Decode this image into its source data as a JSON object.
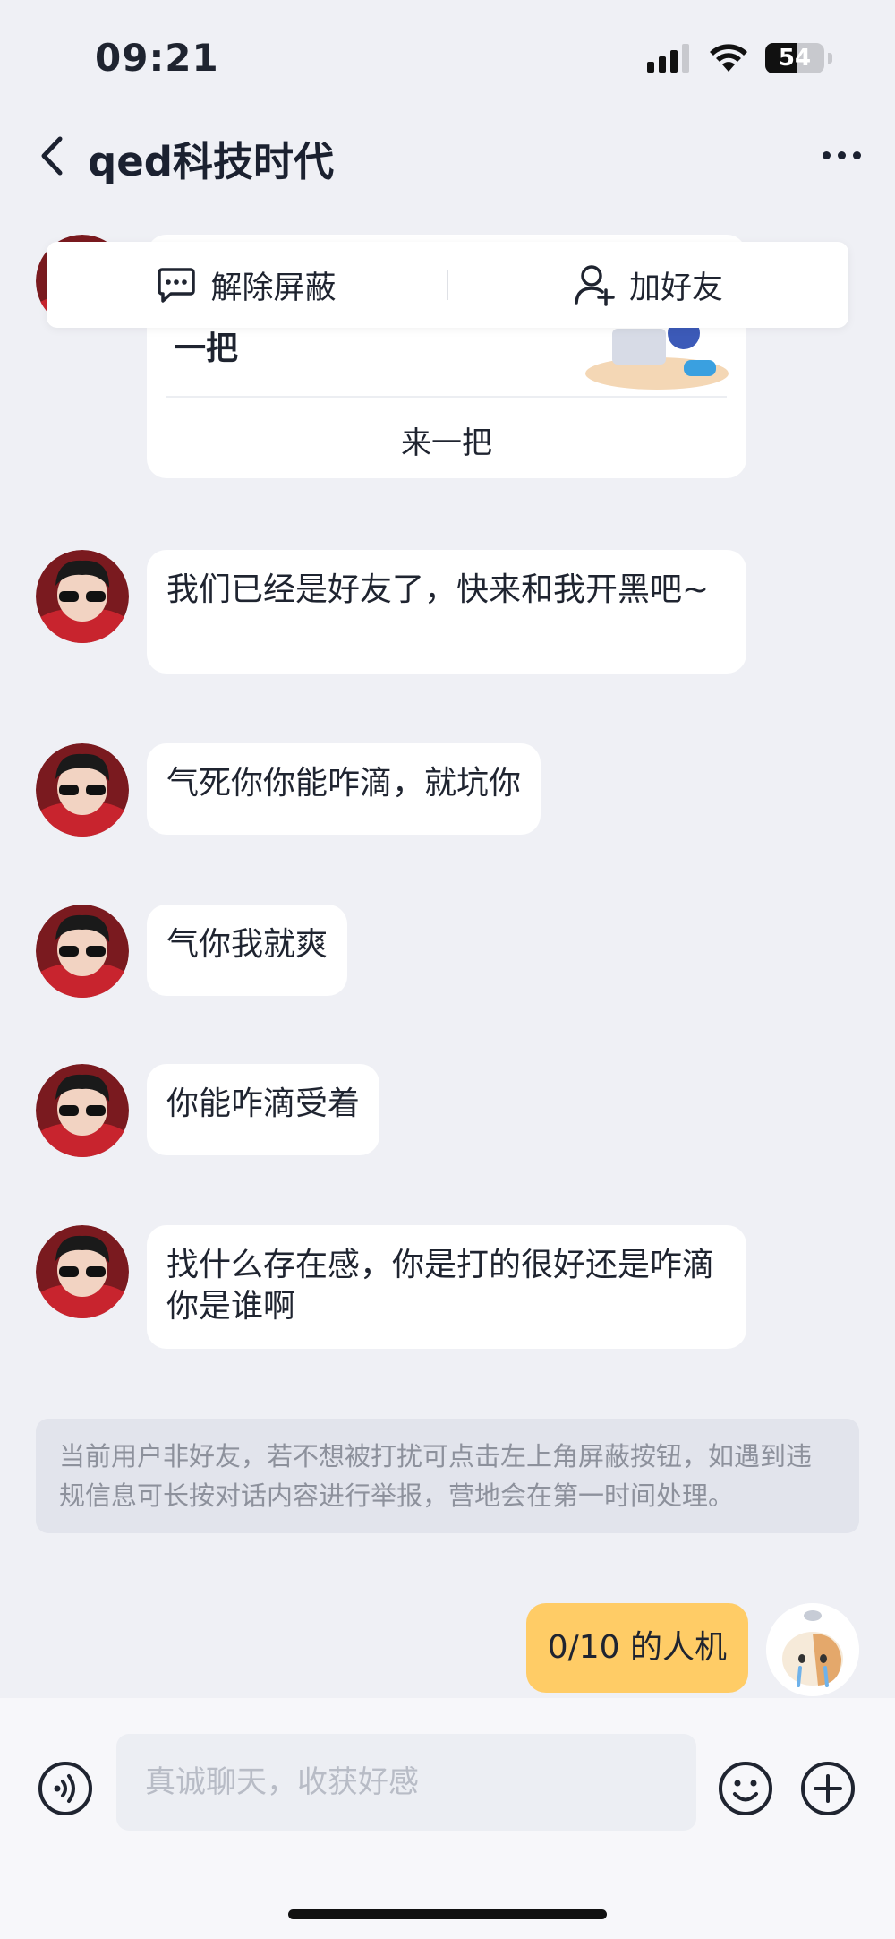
{
  "status_bar": {
    "time": "09:21",
    "battery": "54",
    "battery_level": 0.54,
    "icons": [
      "signal-icon",
      "wifi-icon",
      "battery-icon"
    ]
  },
  "header": {
    "title": "qed科技时代",
    "back_icon": "chevron-left-icon",
    "more_icon": "more-dots-icon"
  },
  "popup_actions": {
    "unblock": {
      "label": "解除屏蔽",
      "icon": "message-dots-icon"
    },
    "add_friend": {
      "label": "加好友",
      "icon": "user-plus-icon"
    }
  },
  "invite_card": {
    "text": "一把",
    "action": "来一把"
  },
  "messages": [
    {
      "from": "them",
      "text": "我们已经是好友了，快来和我开黑吧~"
    },
    {
      "from": "them",
      "text": "气死你你能咋滴，就坑你"
    },
    {
      "from": "them",
      "text": "气你我就爽"
    },
    {
      "from": "them",
      "text": "你能咋滴受着"
    },
    {
      "from": "them",
      "text": "找什么存在感，你是打的很好还是咋滴你是谁啊"
    }
  ],
  "notice": "当前用户非好友，若不想被打扰可点击左上角屏蔽按钮，如遇到违规信息可长按对话内容进行举报，营地会在第一时间处理。",
  "my_message": {
    "from": "me",
    "text": "0/10 的人机"
  },
  "input_bar": {
    "placeholder": "真诚聊天，收获好感",
    "voice_icon": "voice-icon",
    "emoji_icon": "emoji-icon",
    "plus_icon": "plus-icon"
  },
  "colors": {
    "background": "#eff0f5",
    "my_bubble": "#ffcc66",
    "their_bubble": "#ffffff",
    "notice_bg": "#e2e4ec"
  }
}
